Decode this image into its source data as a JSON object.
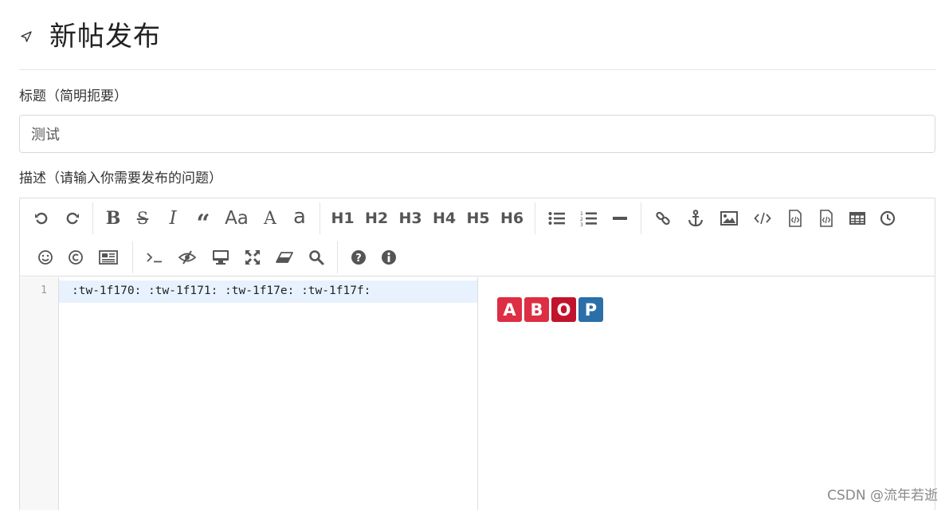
{
  "header": {
    "title": "新帖发布",
    "icon": "send-icon"
  },
  "form": {
    "title_label": "标题（简明扼要）",
    "title_value": "测试",
    "desc_label": "描述（请输入你需要发布的问题）"
  },
  "toolbar": {
    "headings": {
      "h1": "H1",
      "h2": "H2",
      "h3": "H3",
      "h4": "H4",
      "h5": "H5",
      "h6": "H6"
    },
    "case": {
      "aa": "Aa",
      "upper": "A",
      "lower": "a"
    }
  },
  "editor": {
    "line_number": "1",
    "code": ":tw-1f170: :tw-1f171: :tw-1f17e: :tw-1f17f:"
  },
  "preview": {
    "emojis": [
      {
        "char": "A",
        "color": "#dd2e44"
      },
      {
        "char": "B",
        "color": "#dd2e44"
      },
      {
        "char": "O",
        "color": "#c1142c"
      },
      {
        "char": "P",
        "color": "#2a6fa8"
      }
    ]
  },
  "watermark": "CSDN @流年若逝"
}
